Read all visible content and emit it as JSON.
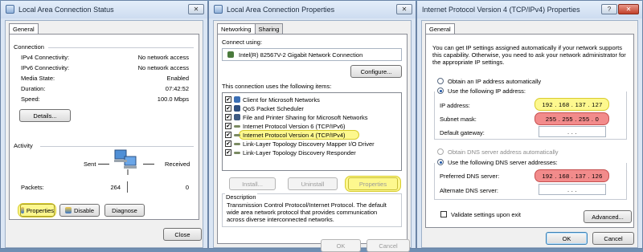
{
  "status": {
    "title": "Local Area Connection Status",
    "close_glyph": "✕",
    "tab": "General",
    "connection_header": "Connection",
    "rows": [
      {
        "label": "IPv4 Connectivity:",
        "value": "No network access"
      },
      {
        "label": "IPv6 Connectivity:",
        "value": "No network access"
      },
      {
        "label": "Media State:",
        "value": "Enabled"
      },
      {
        "label": "Duration:",
        "value": "07:42:52"
      },
      {
        "label": "Speed:",
        "value": "100.0 Mbps"
      }
    ],
    "details_label": "Details...",
    "activity_header": "Activity",
    "sent_label": "Sent",
    "received_label": "Received",
    "packets_label": "Packets:",
    "packets_sent": "264",
    "packets_received": "0",
    "properties_label": "Properties",
    "disable_label": "Disable",
    "diagnose_label": "Diagnose",
    "close_label": "Close",
    "highlight_color": "#fdf88e"
  },
  "props": {
    "title": "Local Area Connection Properties",
    "close_glyph": "✕",
    "tabs": [
      "Networking",
      "Sharing"
    ],
    "connect_using_label": "Connect using:",
    "adapter_name": "Intel(R) 82567V-2 Gigabit Network Connection",
    "configure_label": "Configure...",
    "items_label": "This connection uses the following items:",
    "items": [
      {
        "label": "Client for Microsoft Networks",
        "icon": "network-client-icon",
        "checked": true
      },
      {
        "label": "QoS Packet Scheduler",
        "icon": "qos-icon",
        "checked": true
      },
      {
        "label": "File and Printer Sharing for Microsoft Networks",
        "icon": "file-printer-icon",
        "checked": true
      },
      {
        "label": "Internet Protocol Version 6 (TCP/IPv6)",
        "icon": "protocol-icon",
        "checked": true
      },
      {
        "label": "Internet Protocol Version 4 (TCP/IPv4)",
        "icon": "protocol-icon",
        "checked": true,
        "highlighted": true
      },
      {
        "label": "Link-Layer Topology Discovery Mapper I/O Driver",
        "icon": "protocol-icon",
        "checked": true
      },
      {
        "label": "Link-Layer Topology Discovery Responder",
        "icon": "protocol-icon",
        "checked": true
      }
    ],
    "install_label": "Install...",
    "uninstall_label": "Uninstall",
    "properties_label": "Properties",
    "description_header": "Description",
    "description": "Transmission Control Protocol/Internet Protocol. The default wide area network protocol that provides communication across diverse interconnected networks.",
    "ok_label": "OK",
    "cancel_label": "Cancel",
    "check_glyph": "✔"
  },
  "ipv4": {
    "title": "Internet Protocol Version 4 (TCP/IPv4) Properties",
    "help_glyph": "?",
    "close_glyph": "✕",
    "tab": "General",
    "intro": "You can get IP settings assigned automatically if your network supports this capability. Otherwise, you need to ask your network administrator for the appropriate IP settings.",
    "auto_ip_label": "Obtain an IP address automatically",
    "manual_ip_label": "Use the following IP address:",
    "ip_address_label": "IP address:",
    "ip_address": "192 . 168 . 137 . 127",
    "subnet_label": "Subnet mask:",
    "subnet": "255 . 255 . 255 . 0",
    "gateway_label": "Default gateway:",
    "gateway": ".       .       .",
    "auto_dns_label": "Obtain DNS server address automatically",
    "manual_dns_label": "Use the following DNS server addresses:",
    "preferred_dns_label": "Preferred DNS server:",
    "preferred_dns": "192 . 168 . 137 . 126",
    "alternate_dns_label": "Alternate DNS server:",
    "alternate_dns": ".       .       .",
    "validate_label": "Validate settings upon exit",
    "advanced_label": "Advanced...",
    "ok_label": "OK",
    "cancel_label": "Cancel",
    "highlight_yellow": "#fdf88e",
    "highlight_red": "#f28b8b"
  }
}
